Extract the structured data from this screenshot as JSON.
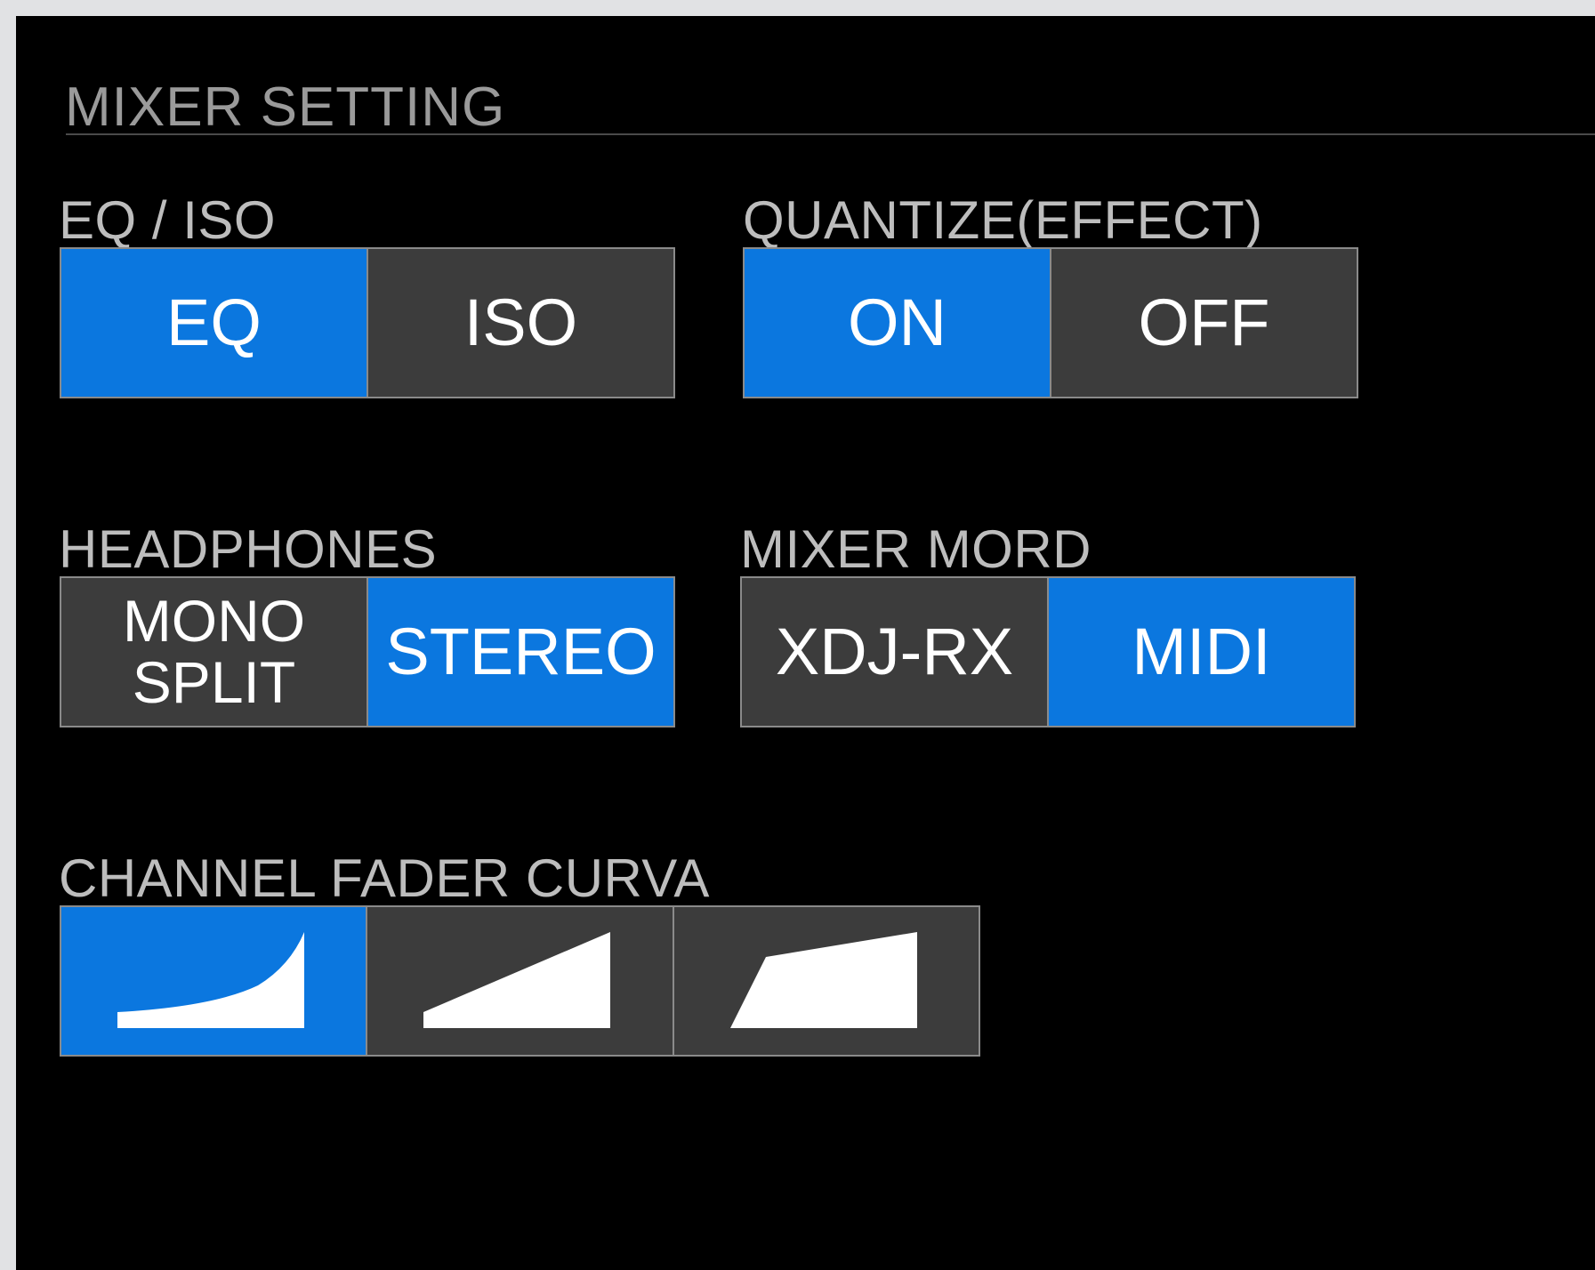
{
  "section": {
    "title": "MIXER SETTING"
  },
  "groups": {
    "eq_iso": {
      "label": "EQ / ISO",
      "options": [
        "EQ",
        "ISO"
      ],
      "selected": "EQ"
    },
    "quantize": {
      "label": "QUANTIZE(EFFECT)",
      "options": [
        "ON",
        "OFF"
      ],
      "selected": "ON"
    },
    "headphones": {
      "label": "HEADPHONES",
      "options": [
        {
          "line1": "MONO",
          "line2": "SPLIT"
        },
        "STEREO"
      ],
      "selected": "STEREO"
    },
    "mixer_mode": {
      "label": "MIXER MORD",
      "options": [
        "XDJ-RX",
        "MIDI"
      ],
      "selected": "MIDI"
    },
    "fader_curve": {
      "label": "CHANNEL FADER CURVA",
      "options": [
        "fast-cut-curve-icon",
        "linear-curve-icon",
        "slow-cut-curve-icon"
      ],
      "selected": "fast-cut-curve-icon"
    }
  },
  "colors": {
    "active": "#0b77df",
    "inactive": "#3c3c3c",
    "background": "#000000"
  }
}
